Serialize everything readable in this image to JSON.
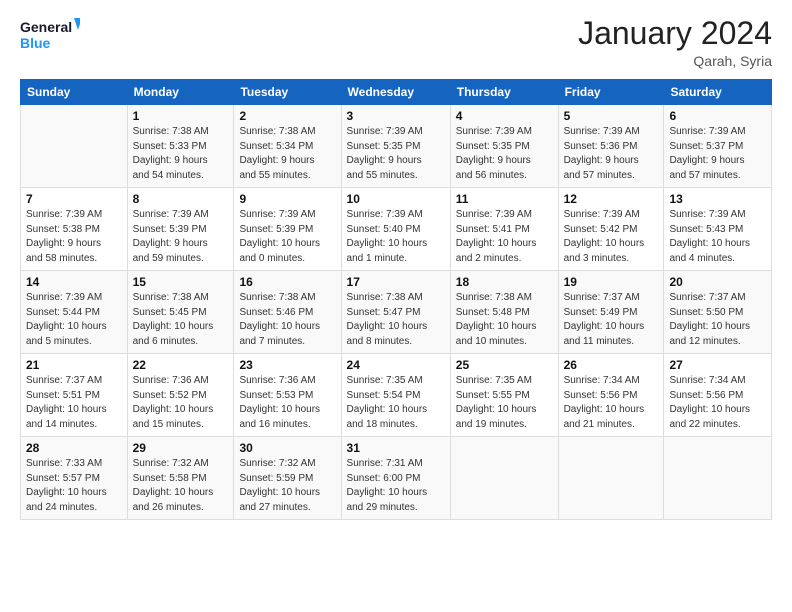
{
  "logo": {
    "line1": "General",
    "line2": "Blue"
  },
  "header": {
    "month": "January 2024",
    "location": "Qarah, Syria"
  },
  "weekdays": [
    "Sunday",
    "Monday",
    "Tuesday",
    "Wednesday",
    "Thursday",
    "Friday",
    "Saturday"
  ],
  "rows": [
    [
      {
        "day": "",
        "info": ""
      },
      {
        "day": "1",
        "info": "Sunrise: 7:38 AM\nSunset: 5:33 PM\nDaylight: 9 hours\nand 54 minutes."
      },
      {
        "day": "2",
        "info": "Sunrise: 7:38 AM\nSunset: 5:34 PM\nDaylight: 9 hours\nand 55 minutes."
      },
      {
        "day": "3",
        "info": "Sunrise: 7:39 AM\nSunset: 5:35 PM\nDaylight: 9 hours\nand 55 minutes."
      },
      {
        "day": "4",
        "info": "Sunrise: 7:39 AM\nSunset: 5:35 PM\nDaylight: 9 hours\nand 56 minutes."
      },
      {
        "day": "5",
        "info": "Sunrise: 7:39 AM\nSunset: 5:36 PM\nDaylight: 9 hours\nand 57 minutes."
      },
      {
        "day": "6",
        "info": "Sunrise: 7:39 AM\nSunset: 5:37 PM\nDaylight: 9 hours\nand 57 minutes."
      }
    ],
    [
      {
        "day": "7",
        "info": "Sunrise: 7:39 AM\nSunset: 5:38 PM\nDaylight: 9 hours\nand 58 minutes."
      },
      {
        "day": "8",
        "info": "Sunrise: 7:39 AM\nSunset: 5:39 PM\nDaylight: 9 hours\nand 59 minutes."
      },
      {
        "day": "9",
        "info": "Sunrise: 7:39 AM\nSunset: 5:39 PM\nDaylight: 10 hours\nand 0 minutes."
      },
      {
        "day": "10",
        "info": "Sunrise: 7:39 AM\nSunset: 5:40 PM\nDaylight: 10 hours\nand 1 minute."
      },
      {
        "day": "11",
        "info": "Sunrise: 7:39 AM\nSunset: 5:41 PM\nDaylight: 10 hours\nand 2 minutes."
      },
      {
        "day": "12",
        "info": "Sunrise: 7:39 AM\nSunset: 5:42 PM\nDaylight: 10 hours\nand 3 minutes."
      },
      {
        "day": "13",
        "info": "Sunrise: 7:39 AM\nSunset: 5:43 PM\nDaylight: 10 hours\nand 4 minutes."
      }
    ],
    [
      {
        "day": "14",
        "info": "Sunrise: 7:39 AM\nSunset: 5:44 PM\nDaylight: 10 hours\nand 5 minutes."
      },
      {
        "day": "15",
        "info": "Sunrise: 7:38 AM\nSunset: 5:45 PM\nDaylight: 10 hours\nand 6 minutes."
      },
      {
        "day": "16",
        "info": "Sunrise: 7:38 AM\nSunset: 5:46 PM\nDaylight: 10 hours\nand 7 minutes."
      },
      {
        "day": "17",
        "info": "Sunrise: 7:38 AM\nSunset: 5:47 PM\nDaylight: 10 hours\nand 8 minutes."
      },
      {
        "day": "18",
        "info": "Sunrise: 7:38 AM\nSunset: 5:48 PM\nDaylight: 10 hours\nand 10 minutes."
      },
      {
        "day": "19",
        "info": "Sunrise: 7:37 AM\nSunset: 5:49 PM\nDaylight: 10 hours\nand 11 minutes."
      },
      {
        "day": "20",
        "info": "Sunrise: 7:37 AM\nSunset: 5:50 PM\nDaylight: 10 hours\nand 12 minutes."
      }
    ],
    [
      {
        "day": "21",
        "info": "Sunrise: 7:37 AM\nSunset: 5:51 PM\nDaylight: 10 hours\nand 14 minutes."
      },
      {
        "day": "22",
        "info": "Sunrise: 7:36 AM\nSunset: 5:52 PM\nDaylight: 10 hours\nand 15 minutes."
      },
      {
        "day": "23",
        "info": "Sunrise: 7:36 AM\nSunset: 5:53 PM\nDaylight: 10 hours\nand 16 minutes."
      },
      {
        "day": "24",
        "info": "Sunrise: 7:35 AM\nSunset: 5:54 PM\nDaylight: 10 hours\nand 18 minutes."
      },
      {
        "day": "25",
        "info": "Sunrise: 7:35 AM\nSunset: 5:55 PM\nDaylight: 10 hours\nand 19 minutes."
      },
      {
        "day": "26",
        "info": "Sunrise: 7:34 AM\nSunset: 5:56 PM\nDaylight: 10 hours\nand 21 minutes."
      },
      {
        "day": "27",
        "info": "Sunrise: 7:34 AM\nSunset: 5:56 PM\nDaylight: 10 hours\nand 22 minutes."
      }
    ],
    [
      {
        "day": "28",
        "info": "Sunrise: 7:33 AM\nSunset: 5:57 PM\nDaylight: 10 hours\nand 24 minutes."
      },
      {
        "day": "29",
        "info": "Sunrise: 7:32 AM\nSunset: 5:58 PM\nDaylight: 10 hours\nand 26 minutes."
      },
      {
        "day": "30",
        "info": "Sunrise: 7:32 AM\nSunset: 5:59 PM\nDaylight: 10 hours\nand 27 minutes."
      },
      {
        "day": "31",
        "info": "Sunrise: 7:31 AM\nSunset: 6:00 PM\nDaylight: 10 hours\nand 29 minutes."
      },
      {
        "day": "",
        "info": ""
      },
      {
        "day": "",
        "info": ""
      },
      {
        "day": "",
        "info": ""
      }
    ]
  ]
}
